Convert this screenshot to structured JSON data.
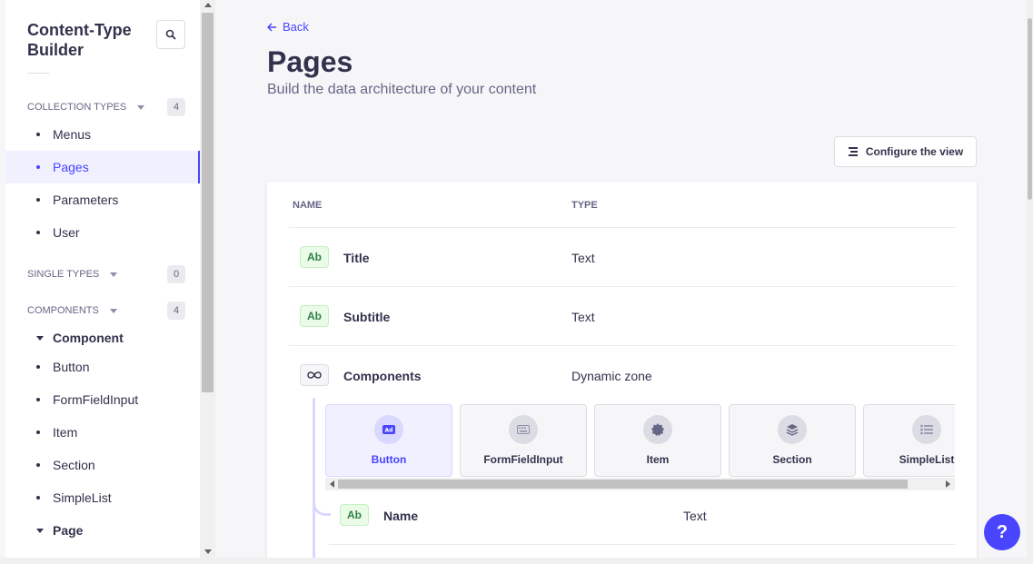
{
  "sidebar": {
    "title": "Content-Type Builder",
    "collection_types": {
      "label": "COLLECTION TYPES",
      "count": "4",
      "items": [
        "Menus",
        "Pages",
        "Parameters",
        "User"
      ]
    },
    "single_types": {
      "label": "SINGLE TYPES",
      "count": "0"
    },
    "components": {
      "label": "COMPONENTS",
      "count": "4",
      "groups": [
        {
          "name": "Component",
          "items": [
            "Button",
            "FormFieldInput",
            "Item",
            "Section",
            "SimpleList"
          ]
        },
        {
          "name": "Page",
          "items": []
        }
      ]
    }
  },
  "main": {
    "back_label": "Back",
    "title": "Pages",
    "subtitle": "Build the data architecture of your content",
    "configure_label": "Configure the view",
    "table": {
      "col_name": "NAME",
      "col_type": "TYPE",
      "rows": [
        {
          "badge": "Ab",
          "name": "Title",
          "type": "Text"
        },
        {
          "badge": "Ab",
          "name": "Subtitle",
          "type": "Text"
        },
        {
          "name": "Components",
          "type": "Dynamic zone"
        }
      ],
      "dz_components": [
        {
          "label": "Button",
          "icon": "ad-icon"
        },
        {
          "label": "FormFieldInput",
          "icon": "keyboard-icon"
        },
        {
          "label": "Item",
          "icon": "badge-icon"
        },
        {
          "label": "Section",
          "icon": "layers-icon"
        },
        {
          "label": "SimpleList",
          "icon": "list-icon"
        }
      ],
      "nested_row": {
        "badge": "Ab",
        "name": "Name",
        "type": "Text"
      }
    },
    "help_label": "?"
  },
  "colors": {
    "accent": "#4945ff",
    "success": "#328048"
  }
}
